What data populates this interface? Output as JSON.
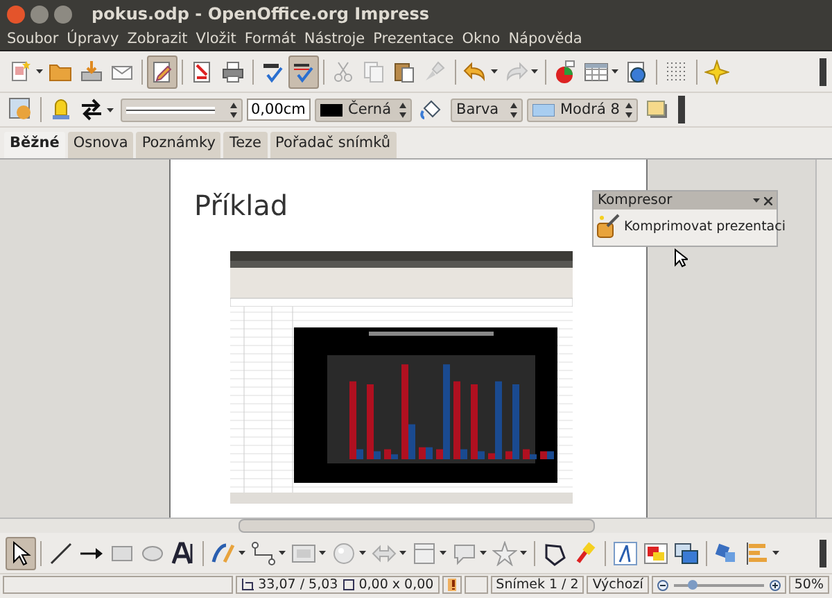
{
  "window": {
    "title": "pokus.odp - OpenOffice.org Impress"
  },
  "menu": [
    "Soubor",
    "Úpravy",
    "Zobrazit",
    "Vložit",
    "Formát",
    "Nástroje",
    "Prezentace",
    "Okno",
    "Nápověda"
  ],
  "standard_toolbar": {
    "edit_mode_on": true,
    "autospellcheck_on": true
  },
  "format_toolbar": {
    "line_width": "0,00cm",
    "line_color": "Černá",
    "area_style": "Barva",
    "area_color": "Modrá 8"
  },
  "tabs": [
    {
      "label": "Běžné",
      "selected": true
    },
    {
      "label": "Osnova",
      "selected": false
    },
    {
      "label": "Poznámky",
      "selected": false
    },
    {
      "label": "Teze",
      "selected": false
    },
    {
      "label": "Pořadač snímků",
      "selected": false
    }
  ],
  "slide": {
    "title": "Příklad"
  },
  "compressor_panel": {
    "title": "Kompresor",
    "button": "Komprimovat prezentaci"
  },
  "drawing_toolbar": {
    "select_on": true
  },
  "status_bar": {
    "position": "33,07 / 5,03",
    "size": "0,00 x 0,00",
    "slide": "Snímek 1 / 2",
    "layout": "Výchozí",
    "zoom_slider": {
      "level": 0.2
    },
    "zoom": "50%"
  }
}
